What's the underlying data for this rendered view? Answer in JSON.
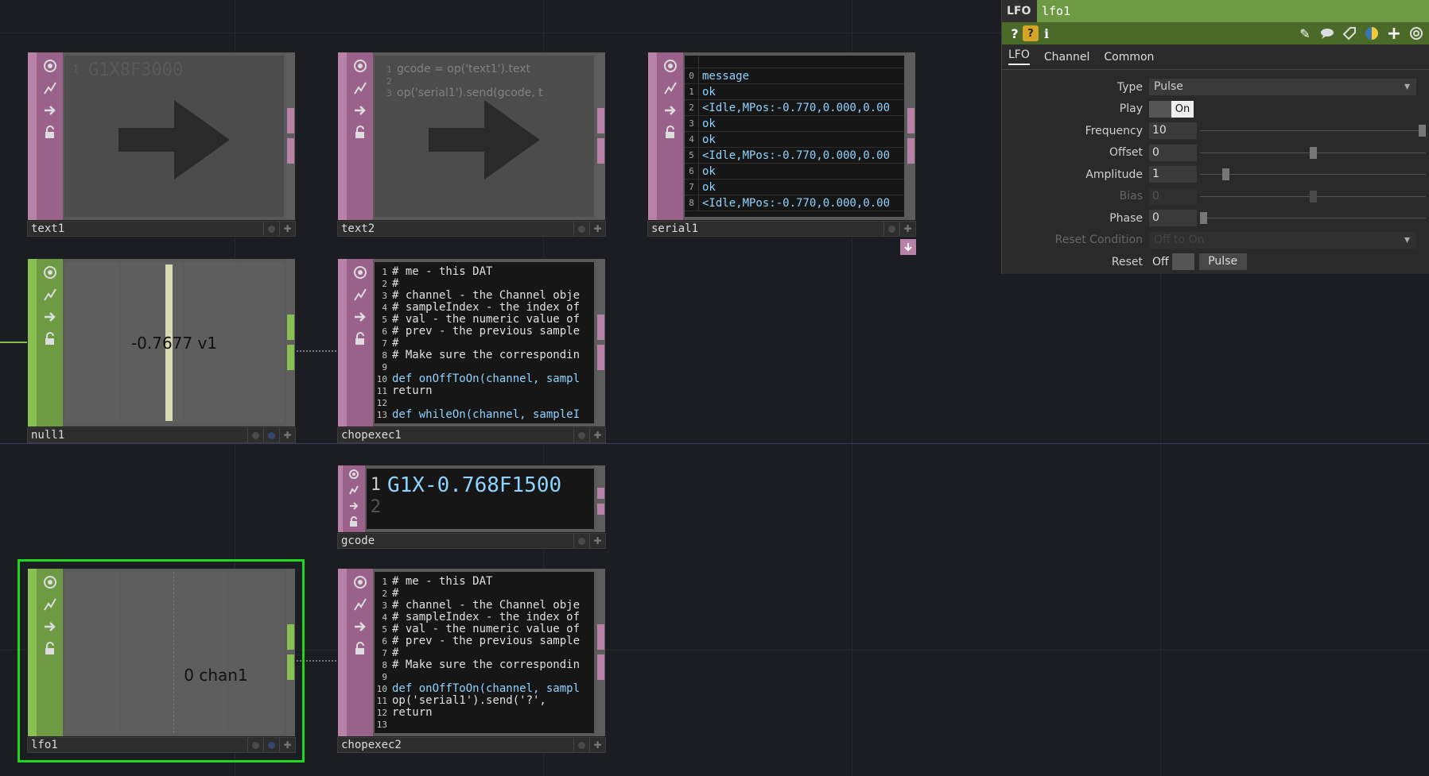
{
  "app": {
    "window": "network-editor"
  },
  "nodes": {
    "text1": {
      "name": "text1",
      "faint_line_no": "1",
      "faint_text": "G1X8F3000"
    },
    "text2": {
      "name": "text2",
      "lines": [
        {
          "n": "1",
          "t": "gcode = op('text1').text"
        },
        {
          "n": "2",
          "t": ""
        },
        {
          "n": "3",
          "t": "op('serial1').send(gcode, t"
        }
      ]
    },
    "serial1": {
      "name": "serial1",
      "rows": [
        {
          "i": "0",
          "v": "message"
        },
        {
          "i": "1",
          "v": "ok"
        },
        {
          "i": "2",
          "v": "<Idle,MPos:-0.770,0.000,0.00"
        },
        {
          "i": "3",
          "v": "ok"
        },
        {
          "i": "4",
          "v": "ok"
        },
        {
          "i": "5",
          "v": "<Idle,MPos:-0.770,0.000,0.00"
        },
        {
          "i": "6",
          "v": "ok"
        },
        {
          "i": "7",
          "v": "ok"
        },
        {
          "i": "8",
          "v": "<Idle,MPos:-0.770,0.000,0.00"
        }
      ]
    },
    "null1": {
      "name": "null1",
      "readout": "-0.7677 v1"
    },
    "chopexec1": {
      "name": "chopexec1",
      "lines": [
        {
          "n": "1",
          "t": "# me - this DAT",
          "kw": false
        },
        {
          "n": "2",
          "t": "#",
          "kw": false
        },
        {
          "n": "3",
          "t": "# channel - the Channel obje",
          "kw": false
        },
        {
          "n": "4",
          "t": "# sampleIndex - the index of",
          "kw": false
        },
        {
          "n": "5",
          "t": "# val - the numeric value of",
          "kw": false
        },
        {
          "n": "6",
          "t": "# prev - the previous sample",
          "kw": false
        },
        {
          "n": "7",
          "t": "#",
          "kw": false
        },
        {
          "n": "8",
          "t": "# Make sure the correspondin",
          "kw": false
        },
        {
          "n": "9",
          "t": "",
          "kw": false
        },
        {
          "n": "10",
          "t": "def onOffToOn(channel, sampl",
          "kw": true
        },
        {
          "n": "11",
          "t": "    return",
          "kw": false
        },
        {
          "n": "12",
          "t": "",
          "kw": false
        },
        {
          "n": "13",
          "t": "def whileOn(channel, sampleI",
          "kw": true
        }
      ]
    },
    "gcode": {
      "name": "gcode",
      "lines": [
        {
          "n": "1",
          "t": "G1X-0.768F1500"
        },
        {
          "n": "2",
          "t": ""
        }
      ]
    },
    "lfo1": {
      "name": "lfo1",
      "readout": "0 chan1"
    },
    "chopexec2": {
      "name": "chopexec2",
      "lines": [
        {
          "n": "1",
          "t": "# me - this DAT",
          "kw": false
        },
        {
          "n": "2",
          "t": "#",
          "kw": false
        },
        {
          "n": "3",
          "t": "# channel - the Channel obje",
          "kw": false
        },
        {
          "n": "4",
          "t": "# sampleIndex - the index of",
          "kw": false
        },
        {
          "n": "5",
          "t": "# val - the numeric value of",
          "kw": false
        },
        {
          "n": "6",
          "t": "# prev - the previous sample",
          "kw": false
        },
        {
          "n": "7",
          "t": "#",
          "kw": false
        },
        {
          "n": "8",
          "t": "# Make sure the correspondin",
          "kw": false
        },
        {
          "n": "9",
          "t": "",
          "kw": false
        },
        {
          "n": "10",
          "t": "def onOffToOn(channel, sampl",
          "kw": true
        },
        {
          "n": "11",
          "t": "    op('serial1').send('?',",
          "kw": false
        },
        {
          "n": "12",
          "t": "    return",
          "kw": false
        },
        {
          "n": "13",
          "t": "",
          "kw": false
        }
      ]
    }
  },
  "param": {
    "op_type": "LFO",
    "op_name": "lfo1",
    "tabs": [
      "LFO",
      "Channel",
      "Common"
    ],
    "active_tab": "LFO",
    "type": {
      "label": "Type",
      "value": "Pulse"
    },
    "play": {
      "label": "Play",
      "value": "On"
    },
    "frequency": {
      "label": "Frequency",
      "value": "10",
      "level": 1.0
    },
    "offset": {
      "label": "Offset",
      "value": "0",
      "level": 0.5
    },
    "amplitude": {
      "label": "Amplitude",
      "value": "1",
      "level": 0.1
    },
    "bias": {
      "label": "Bias",
      "value": "0",
      "level": 0.5
    },
    "phase": {
      "label": "Phase",
      "value": "0",
      "level": 0.0
    },
    "reset_condition": {
      "label": "Reset Condition",
      "value": "Off to On"
    },
    "reset": {
      "label": "Reset",
      "value": "Off",
      "pulse": "Pulse"
    }
  }
}
